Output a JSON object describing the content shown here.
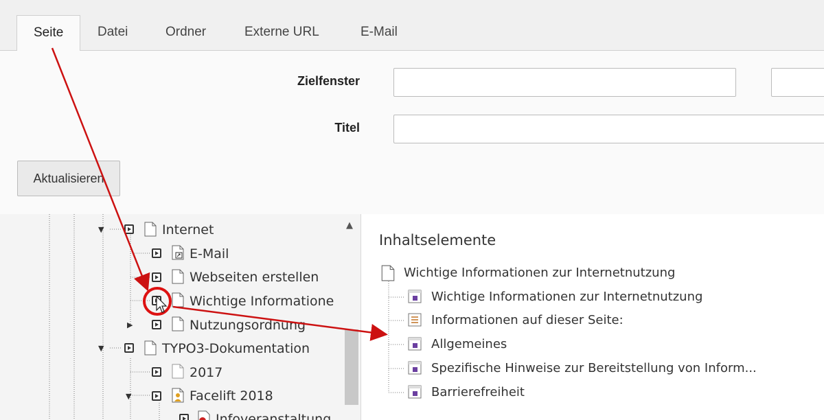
{
  "tabs": [
    {
      "label": "Seite",
      "active": true
    },
    {
      "label": "Datei",
      "active": false
    },
    {
      "label": "Ordner",
      "active": false
    },
    {
      "label": "Externe URL",
      "active": false
    },
    {
      "label": "E-Mail",
      "active": false
    }
  ],
  "form": {
    "target_label": "Zielfenster",
    "target_value": "",
    "title_label": "Titel",
    "title_value": "",
    "update_button": "Aktualisieren"
  },
  "tree": {
    "items": [
      {
        "label": "Internet"
      },
      {
        "label": "E-Mail"
      },
      {
        "label": "Webseiten erstellen"
      },
      {
        "label": "Wichtige Informatione"
      },
      {
        "label": "Nutzungsordnung"
      },
      {
        "label": "TYPO3-Dokumentation"
      },
      {
        "label": "2017"
      },
      {
        "label": "Facelift 2018"
      },
      {
        "label": "Infoveranstaltung"
      }
    ]
  },
  "content": {
    "heading": "Inhaltselemente",
    "page_title": "Wichtige Informationen zur Internetnutzung",
    "elements": [
      {
        "label": "Wichtige Informationen zur Internetnutzung"
      },
      {
        "label": "Informationen auf dieser Seite:"
      },
      {
        "label": "Allgemeines"
      },
      {
        "label": "Spezifische Hinweise zur Bereitstellung von Inform..."
      },
      {
        "label": "Barrierefreiheit"
      }
    ]
  },
  "colors": {
    "annotation": "#cc1111",
    "element_icon": "#6b3fa0"
  }
}
